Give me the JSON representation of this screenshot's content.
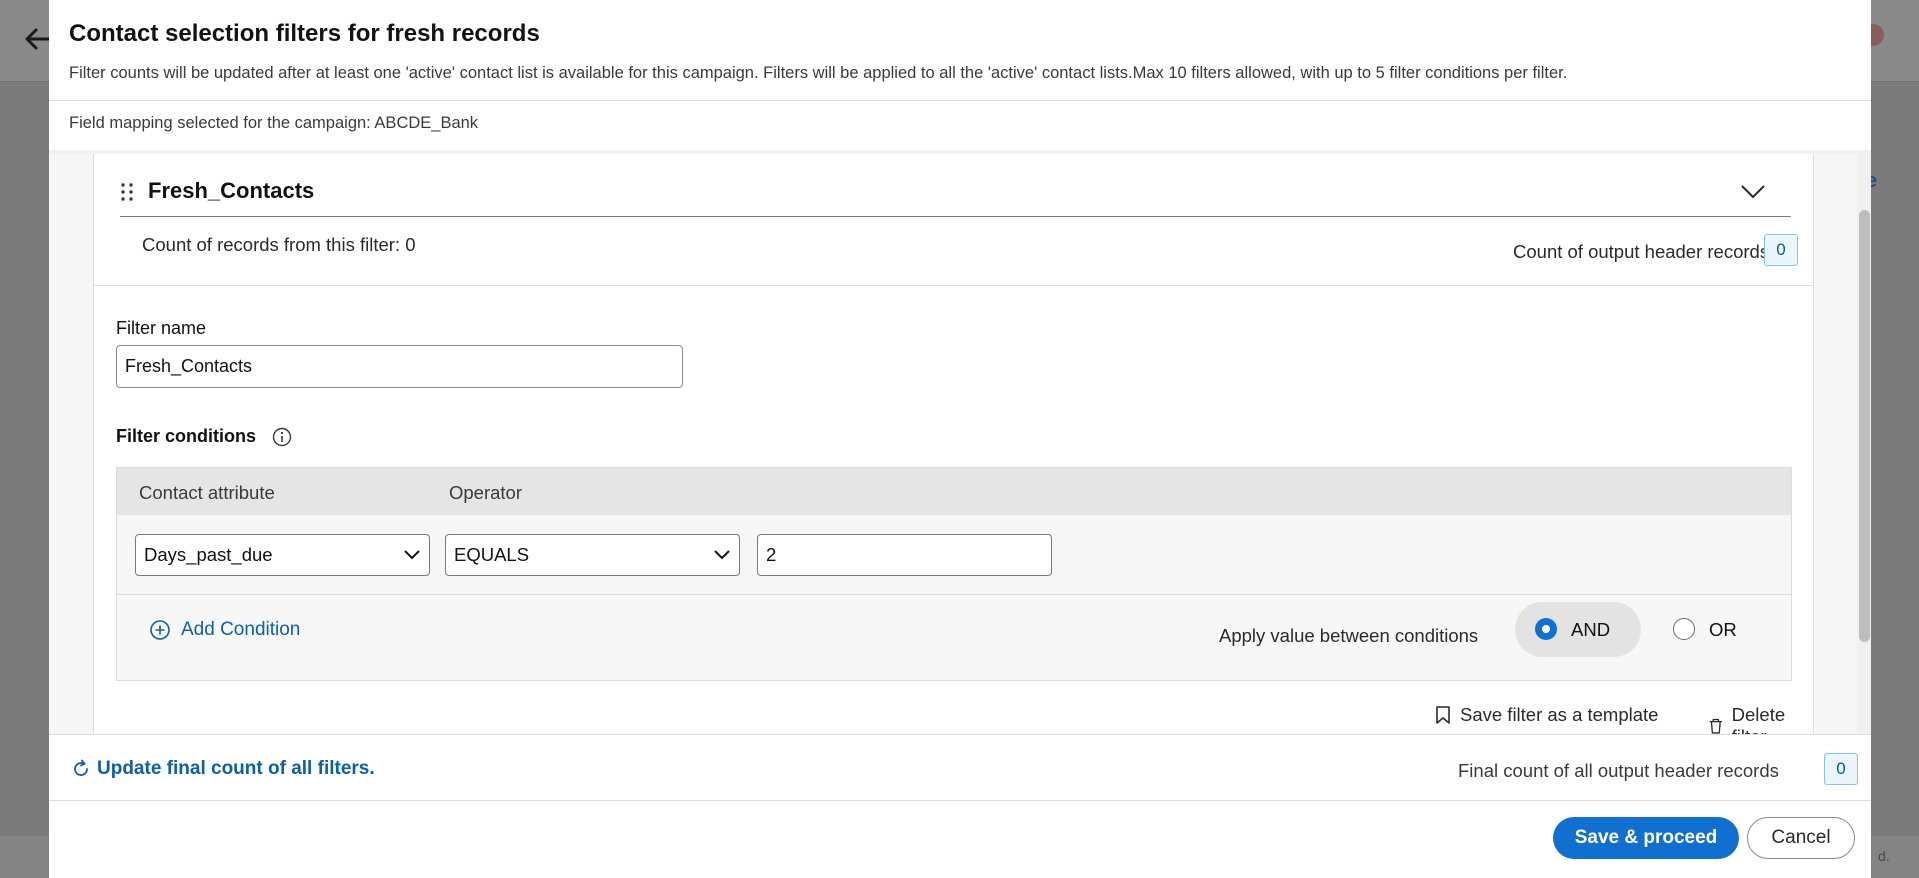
{
  "modal": {
    "title": "Contact selection filters for fresh records",
    "subtitle": "Filter counts will be updated after at least one 'active' contact list is available for this campaign. Filters will be applied to all the 'active' contact lists.Max 10 filters allowed, with up to 5 filter conditions per filter.",
    "mapping_text": "Field mapping selected for the campaign: ABCDE_Bank"
  },
  "filter": {
    "title": "Fresh_Contacts",
    "count_of_records_text": "Count of records from this filter: 0",
    "count_output_label": "Count of output header records",
    "count_output_value": "0",
    "name_label": "Filter name",
    "name_value": "Fresh_Contacts",
    "conditions_label": "Filter conditions",
    "columns": {
      "attribute": "Contact attribute",
      "operator": "Operator"
    },
    "condition": {
      "attribute": "Days_past_due",
      "operator": "EQUALS",
      "value": "2"
    },
    "add_condition_label": "Add Condition",
    "apply_label": "Apply value between conditions",
    "and_label": "AND",
    "or_label": "OR",
    "selected_logic": "AND",
    "save_template_label": "Save filter as a template",
    "delete_label": "Delete filter"
  },
  "footer": {
    "update_link": "Update final count of all filters.",
    "final_count_label": "Final count of all output header records",
    "final_count_value": "0",
    "save_button": "Save & proceed",
    "cancel_button": "Cancel"
  },
  "background": {
    "link_fragment": "e",
    "footer_fragment": "d."
  },
  "colors": {
    "primary": "#1170cf",
    "link": "#0f5fa5",
    "badge_border": "#86c3e6",
    "badge_bg": "#eaf6fc",
    "overlay": "#7b7b7b"
  },
  "icons": {
    "back": "arrow-left-icon",
    "drag": "drag-handle-icon",
    "collapse": "chevron-down-icon",
    "info": "info-icon",
    "add": "plus-circle-icon",
    "refresh": "refresh-icon",
    "bookmark": "bookmark-icon",
    "delete": "trash-icon"
  }
}
